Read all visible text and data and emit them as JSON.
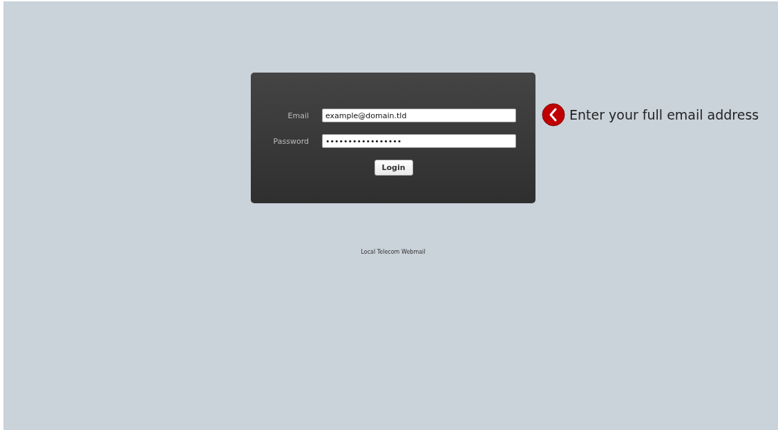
{
  "login_form": {
    "fields": [
      {
        "label": "Email",
        "value": "example@domain.tld"
      },
      {
        "label": "Password",
        "value": "•••••••••••••••••"
      }
    ],
    "button": "Login"
  },
  "hint": {
    "text": "Enter your full email address"
  },
  "footer": "Local Telecom Webmail"
}
